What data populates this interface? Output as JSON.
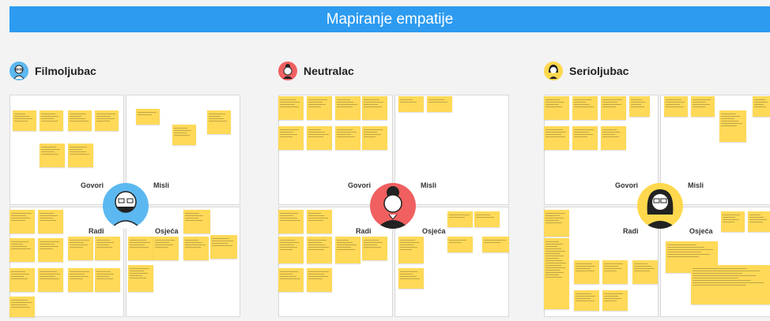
{
  "board": {
    "title": "Mapiranje empatije"
  },
  "colors": {
    "banner": "#2d9bf0",
    "sticky": "#ffd957",
    "persona1_avatar": "#5cb8f0",
    "persona2_avatar": "#f06060",
    "persona3_avatar": "#ffd84d"
  },
  "personas": [
    {
      "name": "Filmoljubac",
      "avatar_icon": "man-glasses-beard-icon",
      "quadrants": {
        "says": "Govori",
        "thinks": "Misli",
        "does": "Radi",
        "feels": "Osjeća"
      }
    },
    {
      "name": "Neutralac",
      "avatar_icon": "woman-bun-icon",
      "quadrants": {
        "says": "Govori",
        "thinks": "Misli",
        "does": "Radi",
        "feels": "Osjeća"
      }
    },
    {
      "name": "Serioljubac",
      "avatar_icon": "woman-glasses-icon",
      "quadrants": {
        "says": "Govori",
        "thinks": "Misli",
        "does": "Radi",
        "feels": "Osjeća"
      }
    }
  ]
}
